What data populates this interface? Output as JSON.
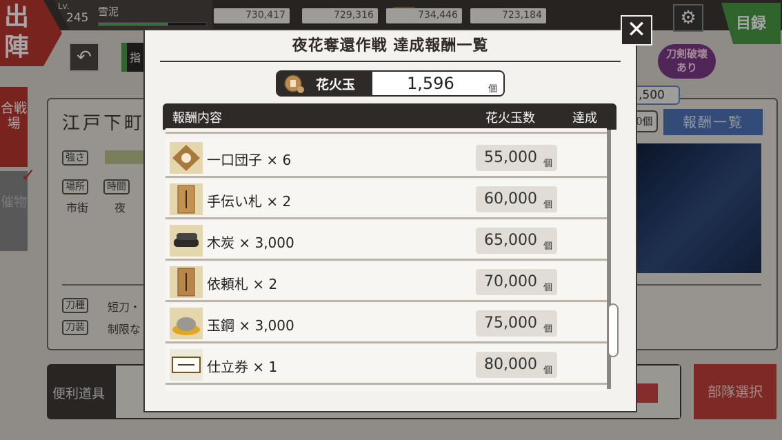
{
  "background": {
    "sortie_label": "出陣",
    "level_label": "Lv.",
    "level": "245",
    "player_name": "雪泥",
    "exp_fraction": 0.65,
    "resources": [
      {
        "icon": "charcoal-icon",
        "value": "730,417"
      },
      {
        "icon": "steel-icon",
        "value": "729,316"
      },
      {
        "icon": "cooling-material-icon",
        "value": "734,446"
      },
      {
        "icon": "whetstone-icon",
        "value": "723,184"
      }
    ],
    "catalog_label": "目録",
    "left_tabs": {
      "battle": "合戦場",
      "event": "催物"
    },
    "green_tab_label": "指",
    "stage_title": "江戸下町",
    "tags": {
      "strength": "強さ",
      "place": "場所",
      "time": "時間",
      "sword_type": "刀種",
      "equipment": "刀装"
    },
    "place_value": "市街",
    "time_value": "夜",
    "sword_type_value": "短刀・",
    "equipment_value": "制限な",
    "sword_break_label": "刀剣破壊\nあり",
    "count_top": ",500",
    "count_unit": "0個",
    "reward_list_button": "報酬一覧",
    "tools_label": "便利道具",
    "squad_select_label": "部隊選択"
  },
  "modal": {
    "title": "夜花奪還作戦 達成報酬一覧",
    "close_label": "✕",
    "currency": {
      "name": "花火玉",
      "value": "1,596",
      "unit": "個"
    },
    "headers": {
      "content": "報酬内容",
      "cost": "花火玉数",
      "achieved": "達成"
    },
    "rewards": [
      {
        "name": "一口団子 × 6",
        "cost": "55,000",
        "unit": "個",
        "icon": "dango-icon"
      },
      {
        "name": "手伝い札 × 2",
        "cost": "60,000",
        "unit": "個",
        "icon": "help-tag-icon"
      },
      {
        "name": "木炭 × 3,000",
        "cost": "65,000",
        "unit": "個",
        "icon": "charcoal-icon"
      },
      {
        "name": "依頼札 × 2",
        "cost": "70,000",
        "unit": "個",
        "icon": "request-tag-icon"
      },
      {
        "name": "玉鋼 × 3,000",
        "cost": "75,000",
        "unit": "個",
        "icon": "tamahagane-icon"
      },
      {
        "name": "仕立券 × 1",
        "cost": "80,000",
        "unit": "個",
        "icon": "tailor-ticket-icon"
      }
    ],
    "scroll_position": 0.62
  },
  "colors": {
    "brand_red": "#b8362f",
    "brand_green": "#4a9a46",
    "panel_dark": "#2e2a27",
    "accent_blue": "#4d74b9"
  }
}
